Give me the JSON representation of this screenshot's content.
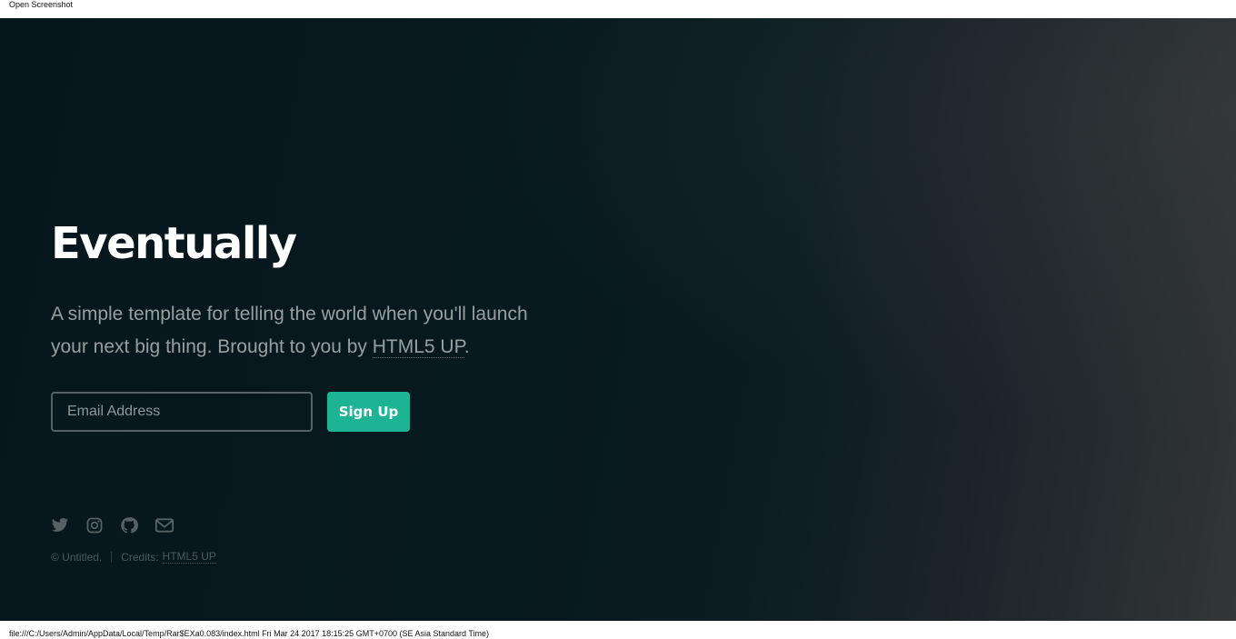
{
  "top_bar": {
    "title": "Open Screenshot"
  },
  "hero": {
    "heading": "Eventually",
    "description_prefix": "A simple template for telling the world when you'll launch your next big thing. Brought to you by ",
    "description_link": "HTML5 UP",
    "description_suffix": "."
  },
  "signup_form": {
    "email_placeholder": "Email Address",
    "email_value": "",
    "submit_label": "Sign Up",
    "accent_color": "#1cb495"
  },
  "social_icons": [
    {
      "name": "twitter-icon"
    },
    {
      "name": "instagram-icon"
    },
    {
      "name": "github-icon"
    },
    {
      "name": "email-icon"
    }
  ],
  "footer": {
    "copyright": "© Untitled.",
    "credits_label": "Credits:",
    "credits_link": "HTML5 UP"
  },
  "status_bar": {
    "text": "file:///C:/Users/Admin/AppData/Local/Temp/Rar$EXa0.083/index.html Fri Mar 24 2017 18:15:25 GMT+0700 (SE Asia Standard Time)"
  }
}
